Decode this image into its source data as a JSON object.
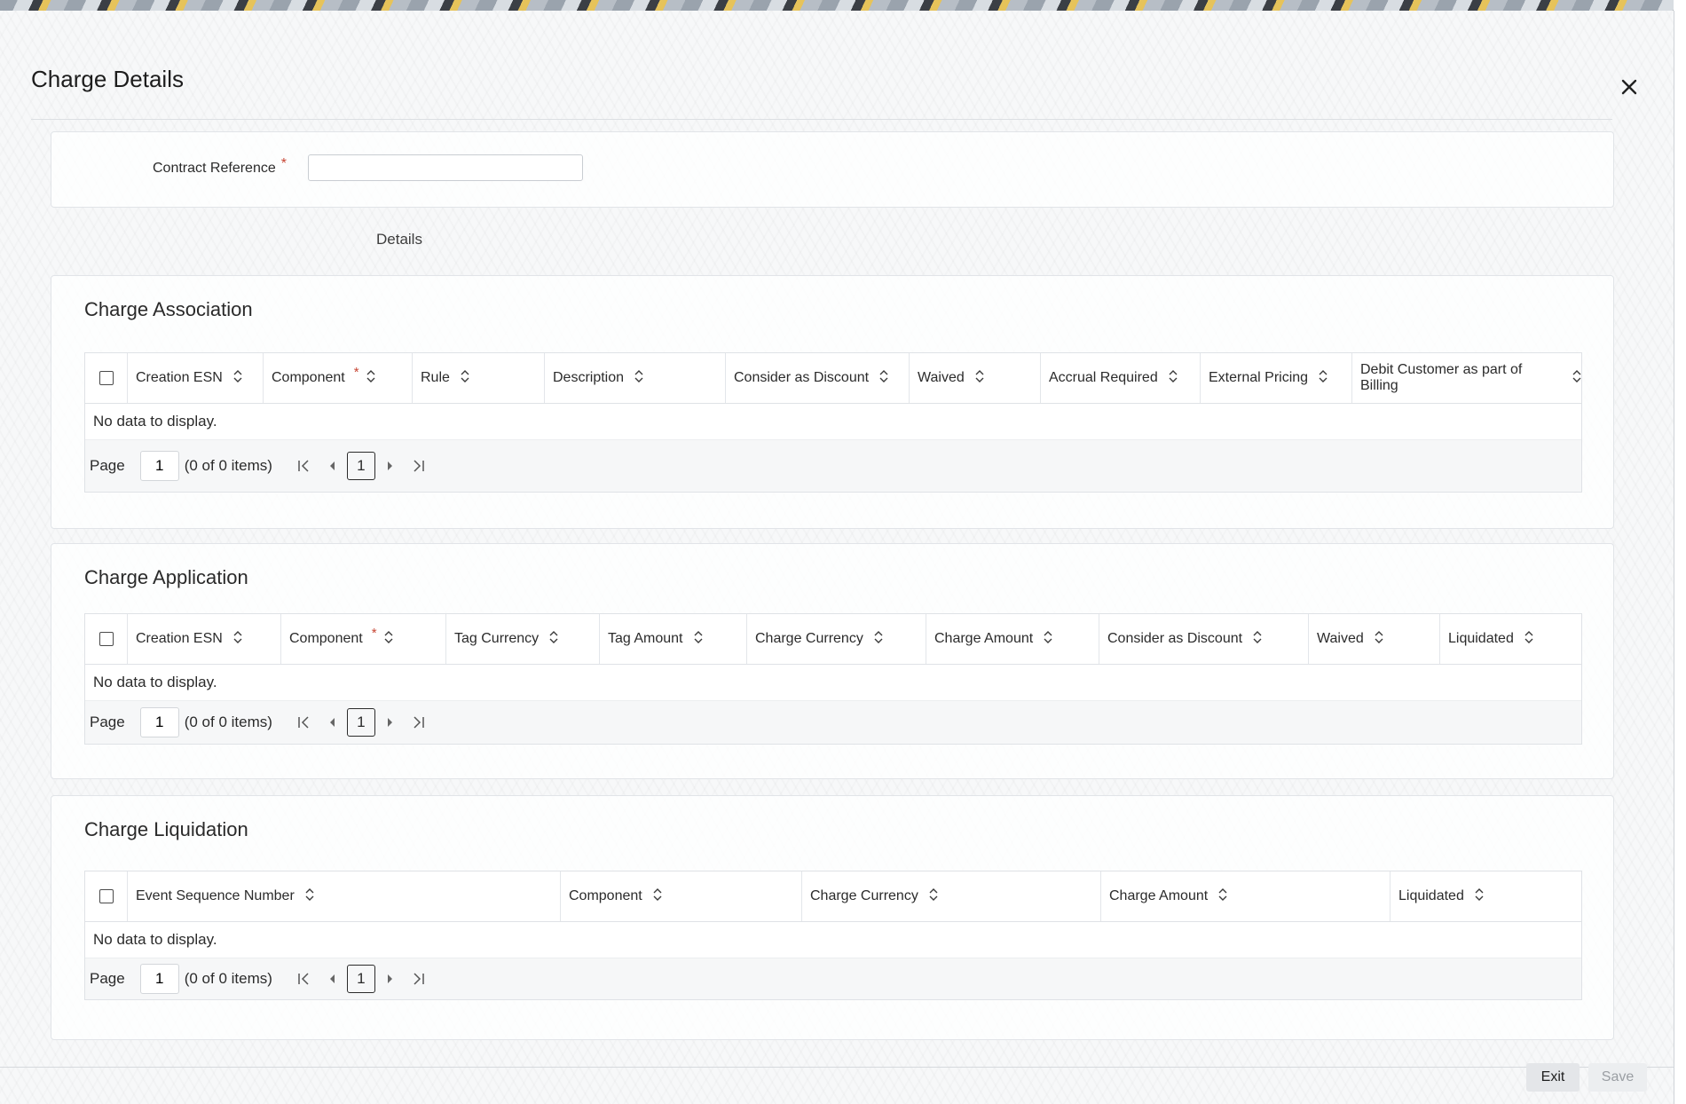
{
  "dialog": {
    "title": "Charge Details"
  },
  "contract": {
    "label": "Contract Reference",
    "required_mark": "*",
    "value": ""
  },
  "tabs": {
    "details": "Details"
  },
  "pager_defaults": {
    "page_label": "Page",
    "page_value": "1",
    "count_text": "(0 of 0 items)",
    "current": "1"
  },
  "charge_association": {
    "title": "Charge Association",
    "columns": [
      "Creation ESN",
      "Component",
      "Rule",
      "Description",
      "Consider as Discount",
      "Waived",
      "Accrual Required",
      "External Pricing",
      "Debit Customer as part of Billing"
    ],
    "required_mark": "*",
    "no_data": "No data to display.",
    "pager": {
      "page_label": "Page",
      "page_value": "1",
      "count_text": "(0 of 0 items)",
      "current": "1"
    }
  },
  "charge_application": {
    "title": "Charge Application",
    "columns": [
      "Creation ESN",
      "Component",
      "Tag Currency",
      "Tag Amount",
      "Charge Currency",
      "Charge Amount",
      "Consider as Discount",
      "Waived",
      "Liquidated"
    ],
    "required_mark": "*",
    "no_data": "No data to display.",
    "pager": {
      "page_label": "Page",
      "page_value": "1",
      "count_text": "(0 of 0 items)",
      "current": "1"
    }
  },
  "charge_liquidation": {
    "title": "Charge Liquidation",
    "columns": [
      "Event Sequence Number",
      "Component",
      "Charge Currency",
      "Charge Amount",
      "Liquidated"
    ],
    "no_data": "No data to display.",
    "pager": {
      "page_label": "Page",
      "page_value": "1",
      "count_text": "(0 of 0 items)",
      "current": "1"
    }
  },
  "footer": {
    "exit_label": "Exit",
    "save_label": "Save"
  },
  "colors": {
    "required": "#c74634",
    "accent_text": "#2b2b2b"
  },
  "icons": {
    "close": "close-icon",
    "sort": "sort-icon",
    "first": "first-page-icon",
    "prev": "previous-page-icon",
    "next": "next-page-icon",
    "last": "last-page-icon"
  }
}
